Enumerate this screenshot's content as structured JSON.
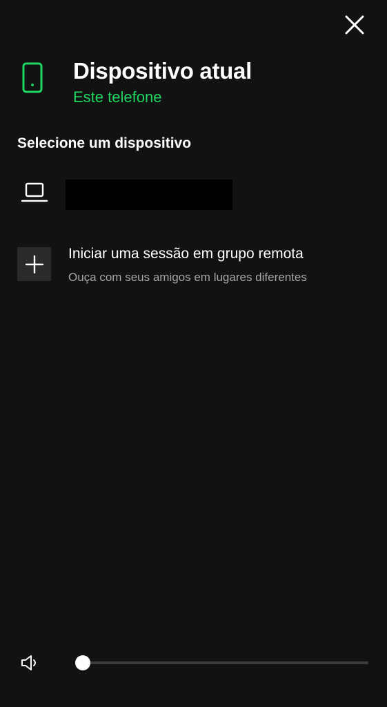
{
  "header": {
    "close_icon": "close-icon"
  },
  "current_device": {
    "icon": "phone-icon",
    "title": "Dispositivo atual",
    "subtitle": "Este telefone",
    "accent_color": "#1ed760"
  },
  "devices_section": {
    "title": "Selecione um dispositivo",
    "items": [
      {
        "icon": "laptop-icon",
        "name_redacted": true
      }
    ]
  },
  "group_session": {
    "icon": "plus-icon",
    "label": "Iniciar uma sessão em grupo remota",
    "sublabel": "Ouça com seus amigos em lugares diferentes"
  },
  "volume": {
    "icon": "speaker-icon",
    "level_fraction": 0.02
  }
}
